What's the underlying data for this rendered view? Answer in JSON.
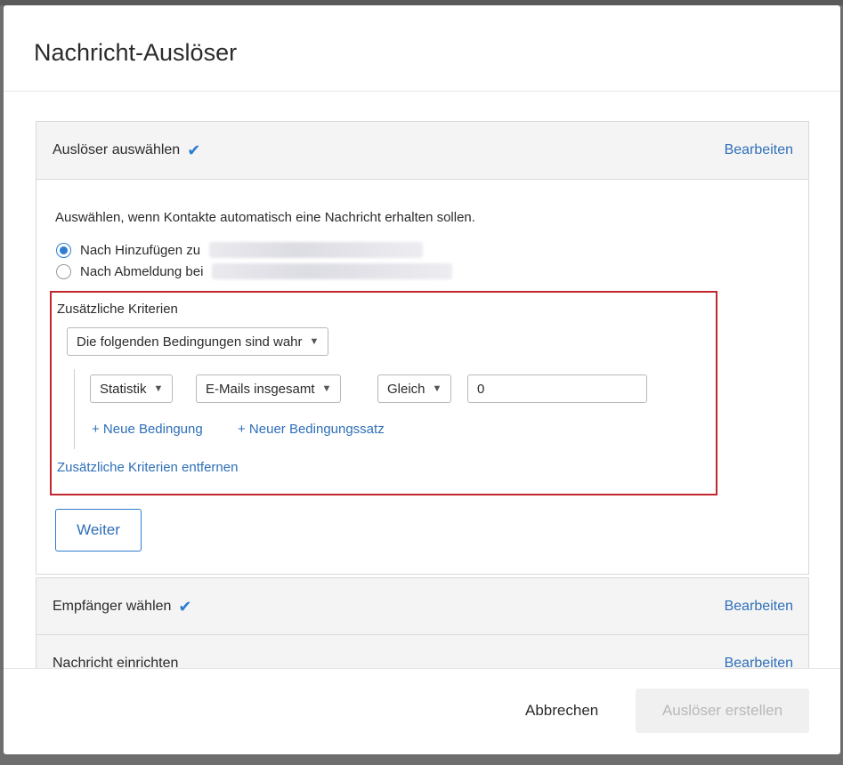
{
  "modal": {
    "title": "Nachricht-Auslöser"
  },
  "sections": {
    "trigger": {
      "title": "Auslöser auswählen",
      "edit_label": "Bearbeiten",
      "intro": "Auswählen, wenn Kontakte automatisch eine Nachricht erhalten sollen.",
      "options": [
        {
          "label": "Nach Hinzufügen zu",
          "selected": true
        },
        {
          "label": "Nach Abmeldung bei",
          "selected": false
        }
      ],
      "criteria": {
        "label": "Zusätzliche Kriterien",
        "mode_select": "Die folgenden Bedingungen sind wahr",
        "condition": {
          "field_type": "Statistik",
          "field": "E-Mails insgesamt",
          "operator": "Gleich",
          "value": "0"
        },
        "add_condition": "+ Neue Bedingung",
        "add_condition_set": "+ Neuer Bedingungssatz",
        "remove_criteria": "Zusätzliche Kriterien entfernen"
      },
      "next_button": "Weiter"
    },
    "recipients": {
      "title": "Empfänger wählen",
      "edit_label": "Bearbeiten"
    },
    "message": {
      "title": "Nachricht einrichten",
      "edit_label": "Bearbeiten"
    }
  },
  "footer": {
    "cancel": "Abbrechen",
    "create": "Auslöser erstellen"
  },
  "colors": {
    "accent": "#2e7dd1",
    "link": "#2e6fb8",
    "highlight_border": "#c1272d",
    "disabled_bg": "#f0f0f0"
  }
}
